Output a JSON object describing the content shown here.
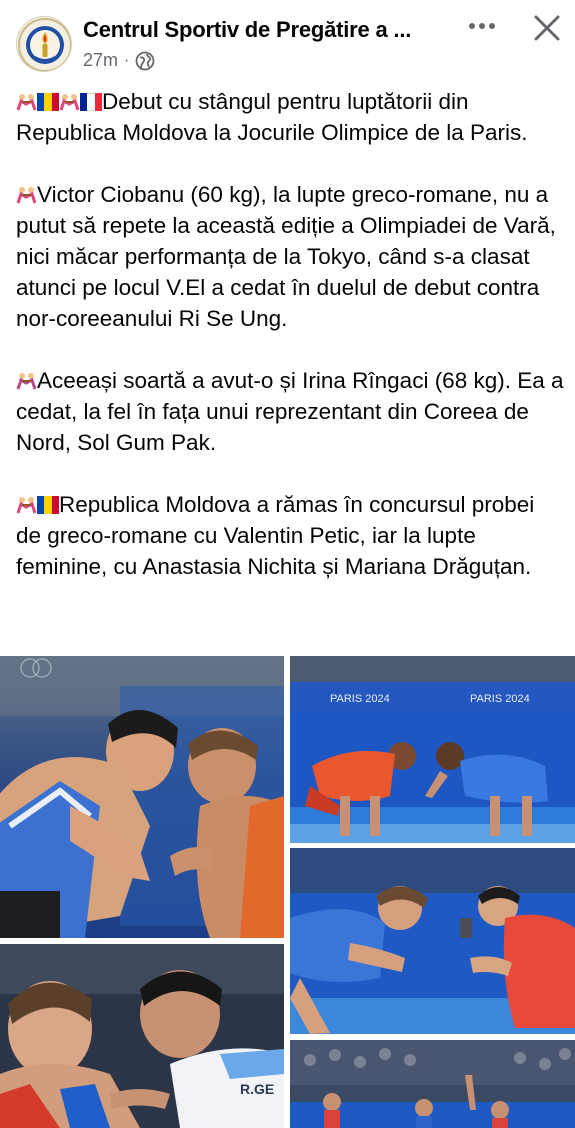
{
  "post": {
    "page_name": "Centrul Sportiv de Pregătire a ...",
    "time": "27m",
    "visibility_icon": "globe-icon",
    "more_icon": "more-dots-icon",
    "close_icon": "close-icon"
  },
  "content": {
    "para1": "Debut cu stângul pentru luptătorii din Republica Moldova la Jocurile Olimpice de la Paris.",
    "para2": "Victor Ciobanu (60 kg), la lupte greco-romane, nu a putut să repete la această ediție a Olimpiadei de Vară, nici măcar performanța de la Tokyo, când s-a clasat atunci pe locul V.El a cedat în duelul de debut contra nor-coreeanului Ri Se Ung.",
    "para3": "Aceeași soartă a avut-o și Irina Rîngaci (68 kg). Ea a cedat, la fel în fața unui reprezentant din Coreea de Nord, Sol Gum Pak.",
    "para4": "Republica Moldova a rămas în concursul probei de greco-romane cu Valentin Petic, iar la lupte feminine, cu Anastasia Nichita și Mariana Drăguțan."
  },
  "photos": {
    "banner_text_1": "PARIS 2024",
    "banner_text_2": "PARIS 2024",
    "singlet_text": "R.GE"
  },
  "colors": {
    "moldova_flag": [
      "#0046ae",
      "#ffd200",
      "#cc092f"
    ],
    "france_flag": [
      "#002395",
      "#ffffff",
      "#ed2939"
    ],
    "secondary_text": "#65676b",
    "arena_blue": "#1e4fa8"
  }
}
